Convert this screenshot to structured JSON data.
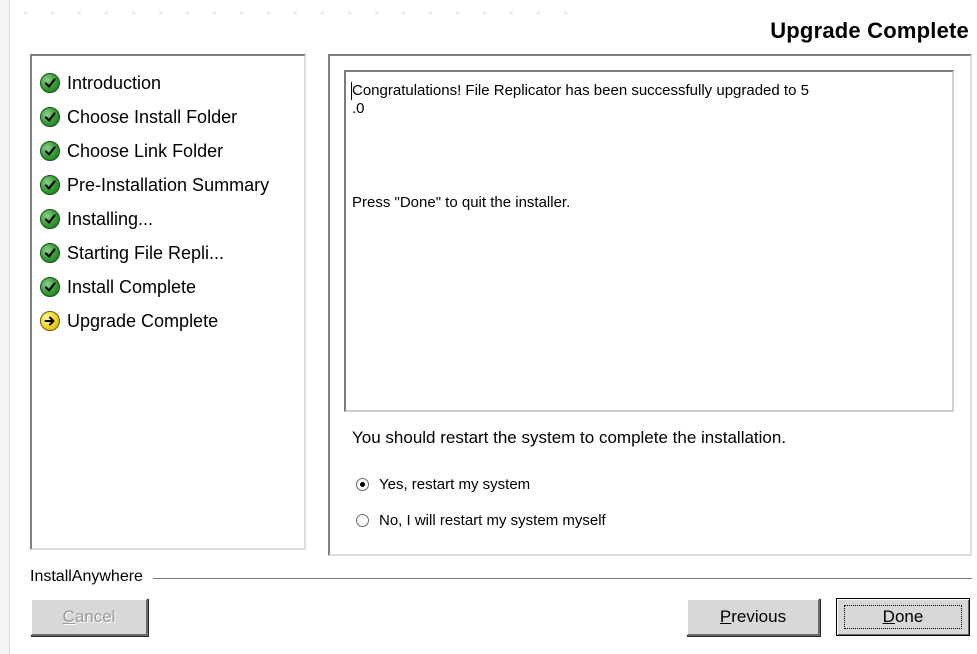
{
  "page": {
    "title": "Upgrade Complete"
  },
  "steps": [
    {
      "label": "Introduction",
      "status": "done",
      "icon": "checkmark-icon"
    },
    {
      "label": "Choose Install Folder",
      "status": "done",
      "icon": "checkmark-icon"
    },
    {
      "label": "Choose Link Folder",
      "status": "done",
      "icon": "checkmark-icon"
    },
    {
      "label": "Pre-Installation Summary",
      "status": "done",
      "icon": "checkmark-icon"
    },
    {
      "label": "Installing...",
      "status": "done",
      "icon": "checkmark-icon"
    },
    {
      "label": "Starting File Repli...",
      "status": "done",
      "icon": "checkmark-icon"
    },
    {
      "label": "Install Complete",
      "status": "done",
      "icon": "checkmark-icon"
    },
    {
      "label": "Upgrade Complete",
      "status": "current",
      "icon": "arrow-right-icon"
    }
  ],
  "main": {
    "message_line1": "Congratulations! File Replicator has been successfully upgraded to 5\n.0",
    "message_line2": "Press \"Done\" to quit the installer.",
    "restart_prompt": "You should restart the system to complete the installation.",
    "options": [
      {
        "label": "Yes, restart my system",
        "selected": true
      },
      {
        "label": "No, I will restart my system myself",
        "selected": false
      }
    ]
  },
  "footer": {
    "vendor": "InstallAnywhere",
    "cancel_label": "Cancel",
    "cancel_mnemonic": "C",
    "previous_label": "Previous",
    "previous_mnemonic": "P",
    "done_label": "Done",
    "done_mnemonic": "D"
  },
  "colors": {
    "done_icon": "#2f9a2f",
    "current_icon": "#f0d226",
    "button_face": "#d8d8d8",
    "disabled_text": "#9a9a9a"
  }
}
